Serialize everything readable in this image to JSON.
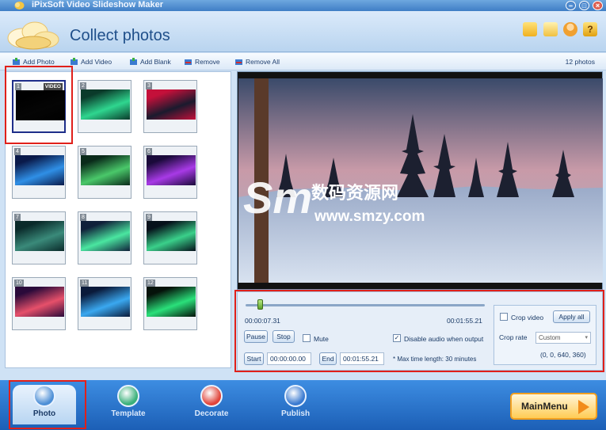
{
  "app": {
    "title": "iPixSoft Video Slideshow Maker"
  },
  "header": {
    "page_title": "Collect photos",
    "icons": [
      "folder-icon",
      "note-icon",
      "user-icon",
      "help-icon"
    ]
  },
  "toolbar": {
    "add_photo": "Add Photo",
    "add_video": "Add Video",
    "add_blank": "Add Blank",
    "remove": "Remove",
    "remove_all": "Remove All",
    "count": "12 photos"
  },
  "thumbnails": [
    {
      "num": "1",
      "badge": "VIDEO",
      "colors": [
        "#000000",
        "#050505"
      ]
    },
    {
      "num": "2",
      "colors": [
        "#0a3a2a",
        "#2fd68f"
      ]
    },
    {
      "num": "3",
      "colors": [
        "#c4103a",
        "#1a1a2e"
      ]
    },
    {
      "num": "4",
      "colors": [
        "#0a1a4a",
        "#2f8fe6"
      ]
    },
    {
      "num": "5",
      "colors": [
        "#0a2a1a",
        "#4ac86a"
      ]
    },
    {
      "num": "6",
      "colors": [
        "#1a0a3a",
        "#a83ae6"
      ]
    },
    {
      "num": "7",
      "colors": [
        "#0a2a2a",
        "#3a8a7a"
      ]
    },
    {
      "num": "8",
      "colors": [
        "#10203a",
        "#4ae6a0"
      ]
    },
    {
      "num": "9",
      "colors": [
        "#05101a",
        "#3ad08a"
      ]
    },
    {
      "num": "10",
      "colors": [
        "#2a0a3a",
        "#e6506a"
      ]
    },
    {
      "num": "11",
      "colors": [
        "#0a1a3a",
        "#3aa8f0"
      ]
    },
    {
      "num": "12",
      "colors": [
        "#05120a",
        "#2ae07a"
      ]
    }
  ],
  "watermark": {
    "cn": "数码资源网",
    "url": "www.smzy.com"
  },
  "player": {
    "progress": 0.05,
    "current_time": "00:00:07.31",
    "total_time": "00:01:55.21",
    "pause": "Pause",
    "stop": "Stop",
    "mute": "Mute",
    "mute_checked": false,
    "disable_audio": "Disable audio when output",
    "disable_audio_checked": true,
    "start": "Start",
    "start_value": "00:00:00.00",
    "end": "End",
    "end_value": "00:01:55.21",
    "max_note": "* Max time length: 30 minutes"
  },
  "crop": {
    "crop_video": "Crop video",
    "crop_checked": false,
    "apply_all": "Apply all",
    "crop_rate": "Crop rate",
    "rate_value": "Custom",
    "coords": "(0, 0, 640, 360)"
  },
  "nav": {
    "tabs": [
      {
        "label": "Photo",
        "color": "#4d8fd6"
      },
      {
        "label": "Template",
        "color": "#3ab07a"
      },
      {
        "label": "Decorate",
        "color": "#e0443a"
      },
      {
        "label": "Publish",
        "color": "#3a7ad0"
      }
    ],
    "main_menu": "MainMenu"
  }
}
